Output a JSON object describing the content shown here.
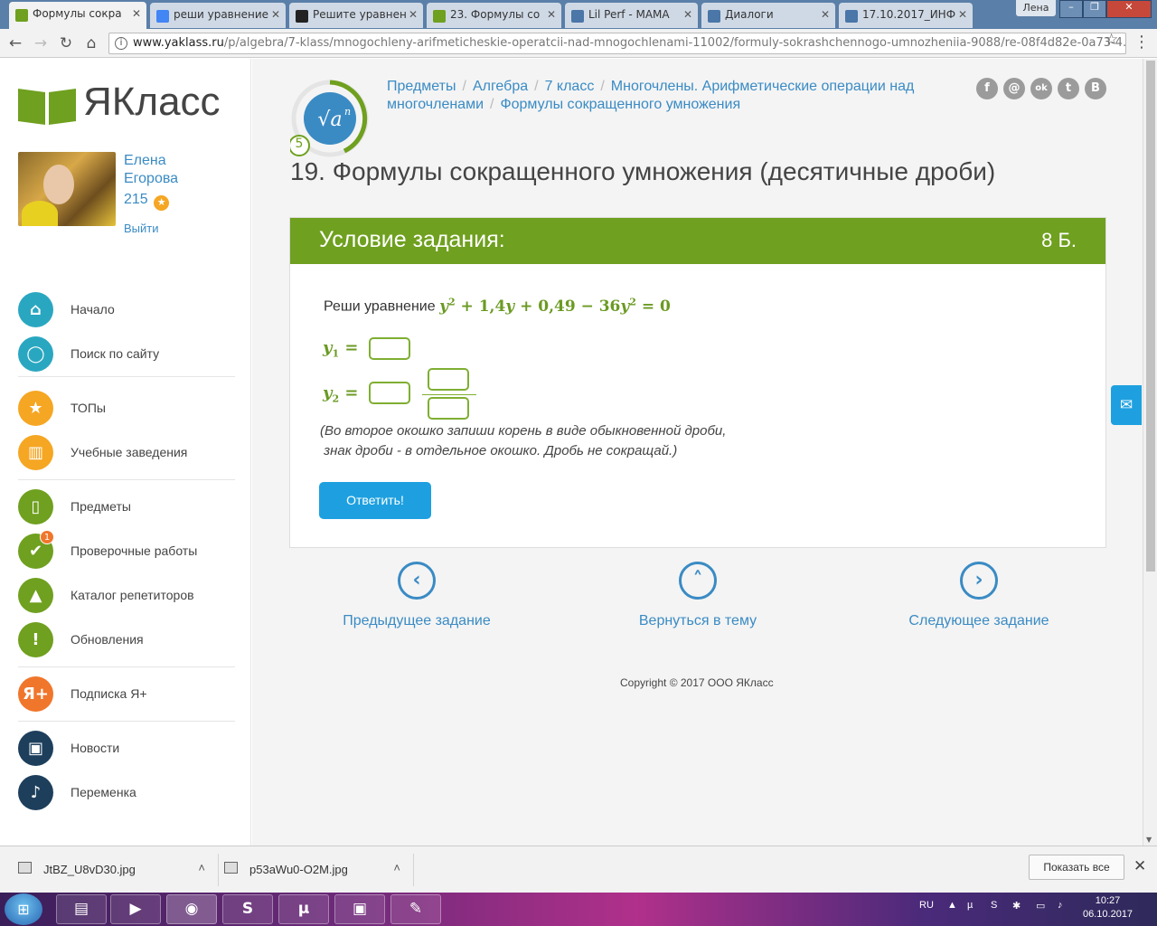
{
  "browser": {
    "tabs": [
      {
        "title": "Формулы сокра",
        "color": "#6fa01f",
        "active": true
      },
      {
        "title": "реши уравнение",
        "color": "#4285f4"
      },
      {
        "title": "Решите уравнен",
        "color": "#222222"
      },
      {
        "title": "23. Формулы со",
        "color": "#6fa01f"
      },
      {
        "title": "Lil Perf - MAMA",
        "color": "#4a76a8"
      },
      {
        "title": "Диалоги",
        "color": "#4a76a8"
      },
      {
        "title": "17.10.2017_ИНФ",
        "color": "#4a76a8"
      }
    ],
    "user_label": "Лена",
    "url_host": "www.yaklass.ru",
    "url_path": "/p/algebra/7-klass/mnogochleny-arifmeticheskie-operatcii-nad-mnogochlenami-11002/formuly-sokrashchennogo-umnozheniia-9088/re-08f4d82e-0a73-4..."
  },
  "sidebar": {
    "logo_text": "ЯКласс",
    "user_first": "Елена",
    "user_last": "Егорова",
    "points": "215",
    "logout": "Выйти",
    "nav": [
      {
        "label": "Начало",
        "icon": "home-icon",
        "color": "#2aa7c0"
      },
      {
        "label": "Поиск по сайту",
        "icon": "search-icon",
        "color": "#2aa7c0"
      },
      {
        "label": "ТОПы",
        "icon": "star-icon",
        "color": "#f5a623"
      },
      {
        "label": "Учебные заведения",
        "icon": "school-icon",
        "color": "#f5a623"
      },
      {
        "label": "Предметы",
        "icon": "book-icon",
        "color": "#6fa01f"
      },
      {
        "label": "Проверочные работы",
        "icon": "check-icon",
        "color": "#6fa01f",
        "badge": "1"
      },
      {
        "label": "Каталог репетиторов",
        "icon": "graduation-cap-icon",
        "color": "#6fa01f"
      },
      {
        "label": "Обновления",
        "icon": "exclamation-icon",
        "color": "#6fa01f"
      },
      {
        "label": "Подписка Я+",
        "icon": "ya-plus-icon",
        "color": "#f0762b",
        "glyph": "Я+"
      },
      {
        "label": "Новости",
        "icon": "chat-icon",
        "color": "#1d3f5c"
      },
      {
        "label": "Переменка",
        "icon": "bell-icon",
        "color": "#1d3f5c"
      }
    ]
  },
  "main": {
    "topic_badge": "5",
    "breadcrumbs": [
      "Предметы",
      "Алгебра",
      "7 класс",
      "Многочлены. Арифметические операции над многочленами",
      "Формулы сокращенного умножения"
    ],
    "social": [
      "f",
      "@",
      "ok",
      "t",
      "B"
    ],
    "title": "19. Формулы сокращенного умножения (десятичные дроби)",
    "panel_title": "Условие задания:",
    "points": "8 Б.",
    "task_prefix": "Реши уравнение",
    "hint_line1": "(Во второе окошко запиши корень в виде обыкновенной дроби,",
    "hint_line2": " знак дроби - в отдельное окошко. Дробь не сокращай.)",
    "submit": "Ответить!",
    "prev": "Предыдущее задание",
    "back": "Вернуться в тему",
    "next": "Следующее задание",
    "copyright": "Copyright © 2017 ООО ЯКласс"
  },
  "downloads": {
    "files": [
      "JtBZ_U8vD30.jpg",
      "p53aWu0-O2M.jpg"
    ],
    "show_all": "Показать все"
  },
  "taskbar": {
    "lang": "RU",
    "time": "10:27",
    "date": "06.10.2017"
  }
}
